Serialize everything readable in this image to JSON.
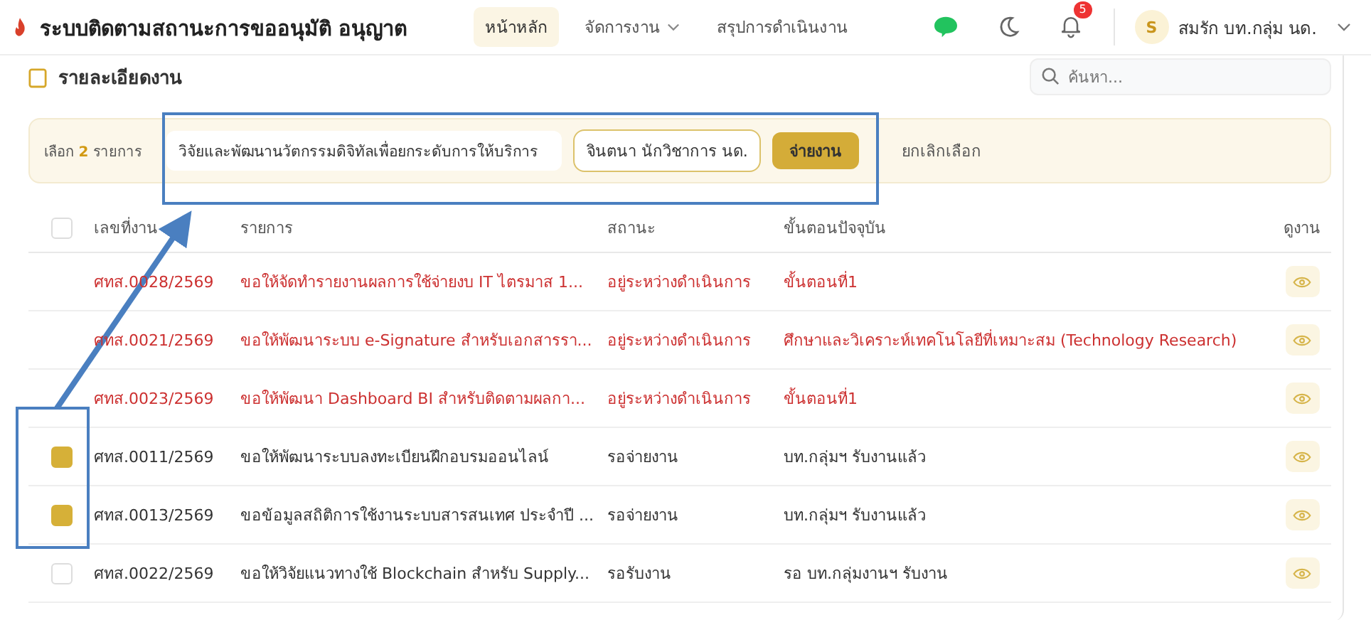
{
  "app": {
    "title": "ระบบติดตามสถานะการขออนุมัติ อนุญาต"
  },
  "nav": [
    {
      "label": "หน้าหลัก",
      "selected": true,
      "dropdown": false
    },
    {
      "label": "จัดการงาน",
      "selected": false,
      "dropdown": true
    },
    {
      "label": "สรุปการดำเนินงาน",
      "selected": false,
      "dropdown": false
    }
  ],
  "notifications": {
    "count": "5"
  },
  "user": {
    "initial": "S",
    "name": "สมรัก บท.กลุ่ม นด."
  },
  "card": {
    "title": "รายละเอียดงาน",
    "search": {
      "placeholder": "ค้นหา..."
    }
  },
  "selection_bar": {
    "prefix": "เลือก",
    "count": "2",
    "suffix": "รายการ",
    "unit": "วิจัยและพัฒนานวัตกรรมดิจิทัลเพื่อยกระดับการให้บริการ",
    "assignee": "จินตนา นักวิชาการ นด.",
    "assign_button": "จ่ายงาน",
    "cancel": "ยกเลิกเลือก"
  },
  "table": {
    "all_checked": false,
    "columns": [
      "เลขที่งาน",
      "รายการ",
      "สถานะ",
      "ขั้นตอนปัจจุบัน",
      "ดูงาน"
    ],
    "rows": [
      {
        "selectable": false,
        "overdue": true,
        "number": "ศทส.0028/2569",
        "item": "ขอให้จัดทำรายงานผลการใช้จ่ายงบ IT ไตรมาส 1...",
        "status": "อยู่ระหว่างดำเนินการ",
        "step": "ขั้นตอนที่1"
      },
      {
        "selectable": false,
        "overdue": true,
        "number": "ศทส.0021/2569",
        "item": "ขอให้พัฒนาระบบ e-Signature สำหรับเอกสารรา...",
        "status": "อยู่ระหว่างดำเนินการ",
        "step": "ศึกษาและวิเคราะห์เทคโนโลยีที่เหมาะสม (Technology Research)"
      },
      {
        "selectable": false,
        "overdue": true,
        "number": "ศทส.0023/2569",
        "item": "ขอให้พัฒนา Dashboard BI สำหรับติดตามผลกา...",
        "status": "อยู่ระหว่างดำเนินการ",
        "step": "ขั้นตอนที่1"
      },
      {
        "selectable": true,
        "checked": true,
        "overdue": false,
        "number": "ศทส.0011/2569",
        "item": "ขอให้พัฒนาระบบลงทะเบียนฝึกอบรมออนไลน์",
        "status": "รอจ่ายงาน",
        "step": "บท.กลุ่มฯ รับงานแล้ว"
      },
      {
        "selectable": true,
        "checked": true,
        "overdue": false,
        "number": "ศทส.0013/2569",
        "item": "ขอข้อมูลสถิติการใช้งานระบบสารสนเทศ ประจำปี ...",
        "status": "รอจ่ายงาน",
        "step": "บท.กลุ่มฯ รับงานแล้ว"
      },
      {
        "selectable": true,
        "checked": false,
        "overdue": false,
        "number": "ศทส.0022/2569",
        "item": "ขอให้วิจัยแนวทางใช้ Blockchain สำหรับ Supply...",
        "status": "รอรับงาน",
        "step": "รอ บท.กลุ่มงานฯ รับงาน"
      }
    ]
  }
}
